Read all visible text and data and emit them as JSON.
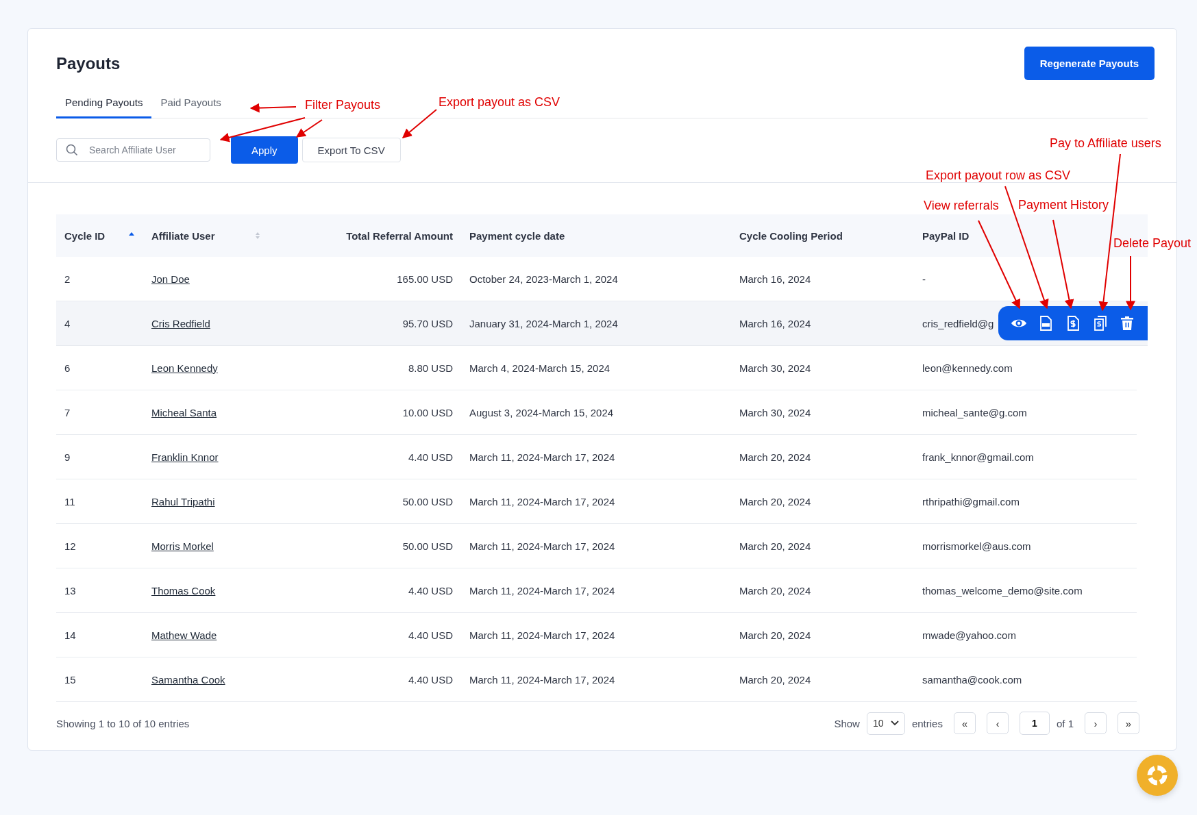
{
  "page": {
    "title": "Payouts",
    "primary_action": "Regenerate Payouts"
  },
  "tabs": [
    {
      "label": "Pending Payouts",
      "selected": true
    },
    {
      "label": "Paid Payouts",
      "selected": false
    }
  ],
  "search": {
    "placeholder": "Search Affiliate User"
  },
  "toolbar_buttons": [
    {
      "label": "Apply",
      "kind": "primary"
    },
    {
      "label": "Export To CSV",
      "kind": "outline"
    }
  ],
  "table": {
    "columns": [
      {
        "label": "Cycle ID",
        "sortable": true,
        "sorted": true
      },
      {
        "label": "Affiliate User",
        "sortable": true,
        "sorted": false
      },
      {
        "label": "Total Referral Amount",
        "sortable": false,
        "sorted": false
      },
      {
        "label": "Payment cycle date",
        "sortable": false,
        "sorted": false
      },
      {
        "label": "Cycle Cooling Period",
        "sortable": false,
        "sorted": false
      },
      {
        "label": "PayPal ID",
        "sortable": false,
        "sorted": false
      }
    ],
    "rows": [
      {
        "cycle_id": "2",
        "user": "Jon Doe",
        "amount": "165.00 USD",
        "cycle_date": "October 24, 2023-March 1, 2024",
        "cooling": "March 16, 2024",
        "paypal": "-",
        "hovered": false
      },
      {
        "cycle_id": "4",
        "user": "Cris Redfield",
        "amount": "95.70 USD",
        "cycle_date": "January 31, 2024-March 1, 2024",
        "cooling": "March 16, 2024",
        "paypal": "cris_redfield@g",
        "hovered": true
      },
      {
        "cycle_id": "6",
        "user": "Leon Kennedy",
        "amount": "8.80 USD",
        "cycle_date": "March 4, 2024-March 15, 2024",
        "cooling": "March 30, 2024",
        "paypal": "leon@kennedy.com",
        "hovered": false
      },
      {
        "cycle_id": "7",
        "user": "Micheal Santa",
        "amount": "10.00 USD",
        "cycle_date": "August 3, 2024-March 15, 2024",
        "cooling": "March 30, 2024",
        "paypal": "micheal_sante@g.com",
        "hovered": false
      },
      {
        "cycle_id": "9",
        "user": "Franklin Knnor",
        "amount": "4.40 USD",
        "cycle_date": "March 11, 2024-March 17, 2024",
        "cooling": "March 20, 2024",
        "paypal": "frank_knnor@gmail.com",
        "hovered": false
      },
      {
        "cycle_id": "11",
        "user": "Rahul Tripathi",
        "amount": "50.00 USD",
        "cycle_date": "March 11, 2024-March 17, 2024",
        "cooling": "March 20, 2024",
        "paypal": "rthripathi@gmail.com",
        "hovered": false
      },
      {
        "cycle_id": "12",
        "user": "Morris Morkel",
        "amount": "50.00 USD",
        "cycle_date": "March 11, 2024-March 17, 2024",
        "cooling": "March 20, 2024",
        "paypal": "morrismorkel@aus.com",
        "hovered": false
      },
      {
        "cycle_id": "13",
        "user": "Thomas Cook",
        "amount": "4.40 USD",
        "cycle_date": "March 11, 2024-March 17, 2024",
        "cooling": "March 20, 2024",
        "paypal": "thomas_welcome_demo@site.com",
        "hovered": false
      },
      {
        "cycle_id": "14",
        "user": "Mathew Wade",
        "amount": "4.40 USD",
        "cycle_date": "March 11, 2024-March 17, 2024",
        "cooling": "March 20, 2024",
        "paypal": "mwade@yahoo.com",
        "hovered": false
      },
      {
        "cycle_id": "15",
        "user": "Samantha Cook",
        "amount": "4.40 USD",
        "cycle_date": "March 11, 2024-March 17, 2024",
        "cooling": "March 20, 2024",
        "paypal": "samantha@cook.com",
        "hovered": false
      }
    ],
    "row_actions": [
      {
        "kind": "view"
      },
      {
        "kind": "csv"
      },
      {
        "kind": "history"
      },
      {
        "kind": "pay"
      },
      {
        "kind": "delete"
      }
    ]
  },
  "footer": {
    "summary": "Showing 1 to 10 of 10 entries",
    "show_label": "Show",
    "page_size": "10",
    "entries_label": "entries",
    "first": "«",
    "prev": "‹",
    "page": "1",
    "of_pages": "of 1",
    "next": "›",
    "last": "»"
  },
  "annotations": [
    {
      "text": "Filter Payouts"
    },
    {
      "text": "Export payout as CSV"
    },
    {
      "text": "Pay to Affiliate users"
    },
    {
      "text": "Export payout row as CSV"
    },
    {
      "text": "View referrals"
    },
    {
      "text": "Payment History"
    },
    {
      "text": "Delete Payout"
    }
  ]
}
